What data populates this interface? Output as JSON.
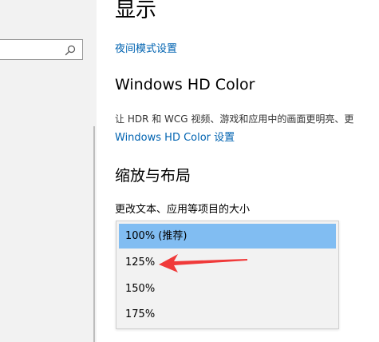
{
  "sidebar": {
    "search": {
      "value": "",
      "placeholder": ""
    }
  },
  "main": {
    "title": "显示",
    "night_light_link": "夜间模式设置",
    "hd_color": {
      "title": "Windows HD Color",
      "description": "让 HDR 和 WCG 视频、游戏和应用中的画面更明亮、更",
      "settings_link": "Windows HD Color 设置"
    },
    "scale_layout": {
      "title": "缩放与布局",
      "dropdown_label": "更改文本、应用等项目的大小",
      "options": [
        {
          "label": "100% (推荐)",
          "selected": true
        },
        {
          "label": "125%",
          "selected": false
        },
        {
          "label": "150%",
          "selected": false
        },
        {
          "label": "175%",
          "selected": false
        }
      ]
    }
  },
  "annotation": {
    "arrow_icon": "red-arrow-icon",
    "color": "#f03a3a"
  },
  "colors": {
    "link": "#0063b1",
    "selected_option": "#81bdf2",
    "sidebar_bg": "#f2f2f2"
  }
}
